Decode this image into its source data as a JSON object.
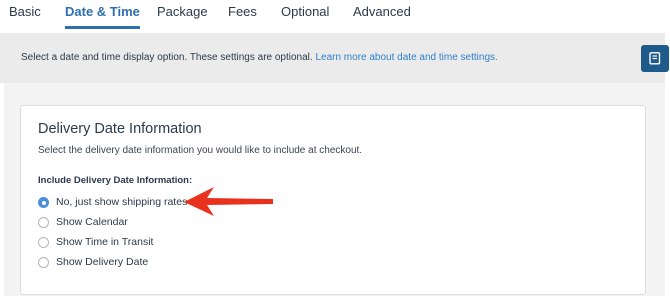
{
  "tabs": [
    {
      "label": "Basic",
      "active": false
    },
    {
      "label": "Date & Time",
      "active": true
    },
    {
      "label": "Package",
      "active": false
    },
    {
      "label": "Fees",
      "active": false
    },
    {
      "label": "Optional",
      "active": false
    },
    {
      "label": "Advanced",
      "active": false
    }
  ],
  "banner": {
    "text": "Select a date and time display option. These settings are optional.",
    "link": "Learn more about date and time settings."
  },
  "help_icon": "book-icon",
  "card": {
    "title": "Delivery Date Information",
    "description": "Select the delivery date information you would like to include at checkout.",
    "field_label": "Include Delivery Date Information:",
    "options": [
      {
        "label": "No, just show shipping rates",
        "checked": true
      },
      {
        "label": "Show Calendar",
        "checked": false
      },
      {
        "label": "Show Time in Transit",
        "checked": false
      },
      {
        "label": "Show Delivery Date",
        "checked": false
      }
    ]
  },
  "colors": {
    "accent": "#2f6fb0",
    "link": "#2f7fc8",
    "radio_checked": "#4a8fd6",
    "help_button": "#1e5b8a",
    "arrow": "#e8321e"
  }
}
